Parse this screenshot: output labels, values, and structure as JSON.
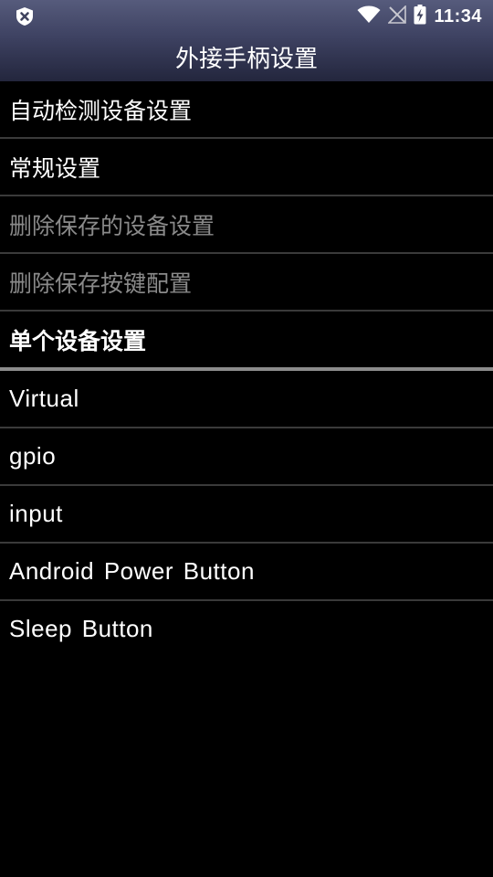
{
  "status_bar": {
    "time": "11:34",
    "left_icon": "shield-x-icon",
    "right_icons": [
      "wifi-icon",
      "no-signal-icon",
      "battery-charging-icon"
    ]
  },
  "header": {
    "title": "外接手柄设置"
  },
  "settings": {
    "items": [
      {
        "label": "自动检测设备设置",
        "enabled": true
      },
      {
        "label": "常规设置",
        "enabled": true
      },
      {
        "label": "删除保存的设备设置",
        "enabled": false
      },
      {
        "label": "删除保存按键配置",
        "enabled": false
      }
    ]
  },
  "section": {
    "title": "单个设备设置"
  },
  "devices": {
    "items": [
      {
        "label": "Virtual"
      },
      {
        "label": "gpio"
      },
      {
        "label": "input"
      },
      {
        "label": "Android Power Button"
      },
      {
        "label": "Sleep Button"
      }
    ]
  },
  "colors": {
    "header_top": "#565b7c",
    "header_bottom": "#23263d",
    "background": "#000000",
    "text": "#ffffff",
    "disabled_text": "#8a8a8a",
    "divider": "#3a3a3a",
    "section_divider": "#8c8c8c"
  }
}
